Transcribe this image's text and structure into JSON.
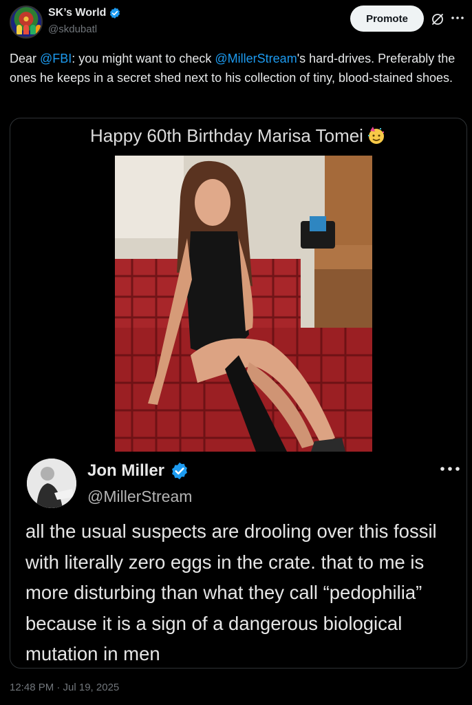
{
  "author": {
    "display_name": "SK’s World",
    "handle": "@skdubatl"
  },
  "header_actions": {
    "promote_label": "Promote",
    "more_icon": "more-horizontal-icon",
    "grok_icon": "grok-icon"
  },
  "tweet": {
    "text_pre": "Dear ",
    "mention1": "@FBI",
    "text_mid": ": you might want to check ",
    "mention2": "@MillerStream",
    "text_post": "'s hard-drives. Preferably the ones he keeps in a secret shed next to his collection of tiny, blood-stained shoes."
  },
  "media": {
    "caption": "Happy 60th Birthday Marisa Tomei",
    "caption_emoji": "party-face-icon",
    "photo_alt_icon": "photo-woman-on-plaid-couch",
    "quoted_tweet": {
      "name": "Jon Miller",
      "handle": "@MillerStream",
      "text": "all the usual suspects are drooling over this fossil with literally zero eggs in the crate. that to me is more disturbing than what they call “pedophilia” because it is a sign of a dangerous biological mutation in men"
    }
  },
  "timestamp": "12:48 PM · Jul 19, 2025",
  "colors": {
    "background": "#000000",
    "text": "#e7e9ea",
    "muted": "#71767b",
    "accent": "#1d9bf0",
    "border": "#2f3336"
  }
}
